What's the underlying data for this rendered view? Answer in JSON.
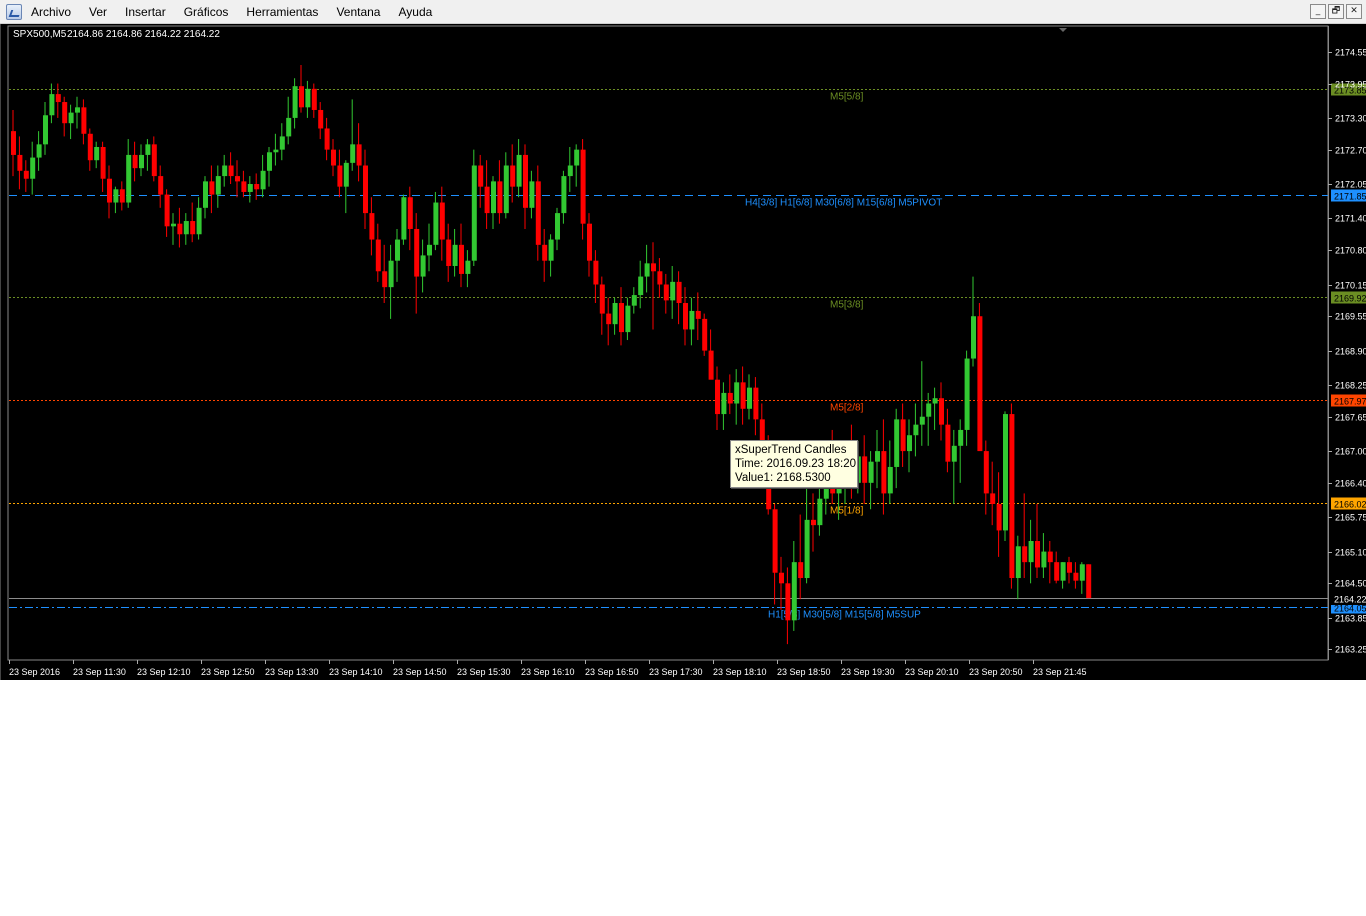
{
  "menubar": {
    "items": [
      "Archivo",
      "Ver",
      "Insertar",
      "Gráficos",
      "Herramientas",
      "Ventana",
      "Ayuda"
    ],
    "window_buttons": [
      "_",
      "🗗",
      "✕"
    ]
  },
  "chart_header": {
    "symbol": "SPX500,M5",
    "ohlc": "2164.86 2164.86 2164.22 2164.22"
  },
  "tooltip": {
    "title": "xSuperTrend Candles",
    "time": "Time: 2016.09.23 18:20",
    "value": "Value1: 2168.5300"
  },
  "colors": {
    "background": "#000000",
    "bull": "#32c832",
    "bear": "#ff0000",
    "axis_text": "#ffffff",
    "m5_58": "#6b8e23",
    "pivot": "#1e90ff",
    "m5_38": "#6b8e23",
    "m5_28": "#ff4500",
    "m5_18": "#ffa500",
    "sup": "#1e90ff"
  },
  "chart_data": {
    "type": "candlestick",
    "timeframe": "M5",
    "y_ticks": [
      "2174.55",
      "2173.95",
      "2173.30",
      "2172.70",
      "2172.05",
      "2171.40",
      "2170.80",
      "2170.15",
      "2169.55",
      "2168.90",
      "2168.25",
      "2167.65",
      "2167.00",
      "2166.40",
      "2165.75",
      "2165.10",
      "2164.50",
      "2163.85",
      "2163.25"
    ],
    "ylim": [
      2163.05,
      2175.0
    ],
    "x_tick_labels": [
      "23 Sep 2016",
      "23 Sep 11:30",
      "23 Sep 12:10",
      "23 Sep 12:50",
      "23 Sep 13:30",
      "23 Sep 14:10",
      "23 Sep 14:50",
      "23 Sep 15:30",
      "23 Sep 16:10",
      "23 Sep 16:50",
      "23 Sep 17:30",
      "23 Sep 18:10",
      "23 Sep 18:50",
      "23 Sep 19:30",
      "23 Sep 20:10",
      "23 Sep 20:50",
      "23 Sep 21:45"
    ],
    "levels": [
      {
        "label": "M5[5/8]",
        "price": 2173.85,
        "tag": "2173.85",
        "color": "#6b8e23",
        "style": "dot",
        "tag_bg": "#6b8e23",
        "label_color": "#6b8e23"
      },
      {
        "label": "H4[3/8] H1[6/8] M30[6/8] M15[6/8] M5PIVOT",
        "price": 2171.85,
        "tag": "2171.85",
        "color": "#1e90ff",
        "style": "dash",
        "tag_bg": "#1e90ff",
        "label_color": "#1e90ff"
      },
      {
        "label": "M5[3/8]",
        "price": 2169.92,
        "tag": "2169.92",
        "color": "#6b8e23",
        "style": "dot",
        "tag_bg": "#6b8e23",
        "label_color": "#6b8e23"
      },
      {
        "label": "M5[2/8]",
        "price": 2167.97,
        "tag": "2167.97",
        "color": "#ff4500",
        "style": "dot",
        "tag_bg": "#ff4500",
        "label_color": "#ff4500"
      },
      {
        "label": "M5[1/8]",
        "price": 2166.02,
        "tag": "2166.02",
        "color": "#ffa500",
        "style": "dot",
        "tag_bg": "#ffa500",
        "label_color": "#ffa500"
      },
      {
        "label": "H1[5/8] M30[5/8] M15[5/8] M5SUP",
        "price": 2164.05,
        "tag": "2164.05",
        "color": "#1e90ff",
        "style": "dashdot",
        "tag_bg": "#1e90ff",
        "label_color": "#1e90ff"
      }
    ],
    "current_price": {
      "price": 2164.22,
      "tag": "2164.22"
    },
    "candles": [
      [
        2173.05,
        2173.45,
        2172.2,
        2172.6
      ],
      [
        2172.6,
        2172.95,
        2171.95,
        2172.3
      ],
      [
        2172.3,
        2172.5,
        2171.9,
        2172.15
      ],
      [
        2172.15,
        2172.85,
        2171.85,
        2172.55
      ],
      [
        2172.55,
        2173.05,
        2172.3,
        2172.8
      ],
      [
        2172.8,
        2173.6,
        2172.6,
        2173.35
      ],
      [
        2173.35,
        2173.95,
        2173.2,
        2173.75
      ],
      [
        2173.75,
        2173.95,
        2173.3,
        2173.6
      ],
      [
        2173.6,
        2173.7,
        2172.95,
        2173.2
      ],
      [
        2173.2,
        2173.55,
        2172.9,
        2173.4
      ],
      [
        2173.4,
        2173.7,
        2173.1,
        2173.5
      ],
      [
        2173.5,
        2173.65,
        2172.8,
        2173.0
      ],
      [
        2173.0,
        2173.1,
        2172.3,
        2172.5
      ],
      [
        2172.5,
        2172.85,
        2172.35,
        2172.75
      ],
      [
        2172.75,
        2172.85,
        2171.9,
        2172.15
      ],
      [
        2172.15,
        2172.4,
        2171.4,
        2171.7
      ],
      [
        2171.7,
        2172.0,
        2171.5,
        2171.95
      ],
      [
        2171.95,
        2172.1,
        2171.55,
        2171.7
      ],
      [
        2171.7,
        2172.9,
        2171.6,
        2172.6
      ],
      [
        2172.6,
        2172.85,
        2172.1,
        2172.35
      ],
      [
        2172.35,
        2172.8,
        2172.2,
        2172.6
      ],
      [
        2172.6,
        2172.9,
        2172.3,
        2172.8
      ],
      [
        2172.8,
        2172.95,
        2172.1,
        2172.2
      ],
      [
        2172.2,
        2172.4,
        2171.6,
        2171.85
      ],
      [
        2171.85,
        2171.95,
        2171.05,
        2171.25
      ],
      [
        2171.25,
        2171.5,
        2170.9,
        2171.3
      ],
      [
        2171.3,
        2171.6,
        2170.85,
        2171.1
      ],
      [
        2171.1,
        2171.5,
        2170.9,
        2171.35
      ],
      [
        2171.35,
        2171.7,
        2170.95,
        2171.1
      ],
      [
        2171.1,
        2171.8,
        2171.0,
        2171.6
      ],
      [
        2171.6,
        2172.2,
        2171.4,
        2172.1
      ],
      [
        2172.1,
        2172.4,
        2171.5,
        2171.85
      ],
      [
        2171.85,
        2172.4,
        2171.6,
        2172.2
      ],
      [
        2172.2,
        2172.6,
        2172.0,
        2172.4
      ],
      [
        2172.4,
        2172.65,
        2172.05,
        2172.2
      ],
      [
        2172.2,
        2172.5,
        2171.8,
        2172.1
      ],
      [
        2172.1,
        2172.3,
        2171.8,
        2171.9
      ],
      [
        2171.9,
        2172.2,
        2171.7,
        2172.05
      ],
      [
        2172.05,
        2172.25,
        2171.75,
        2171.95
      ],
      [
        2171.95,
        2172.6,
        2171.8,
        2172.3
      ],
      [
        2172.3,
        2172.75,
        2172.0,
        2172.65
      ],
      [
        2172.65,
        2173.0,
        2172.4,
        2172.7
      ],
      [
        2172.7,
        2173.2,
        2172.5,
        2172.95
      ],
      [
        2172.95,
        2173.7,
        2172.8,
        2173.3
      ],
      [
        2173.3,
        2174.05,
        2173.1,
        2173.9
      ],
      [
        2173.9,
        2174.3,
        2173.4,
        2173.5
      ],
      [
        2173.5,
        2174.0,
        2173.3,
        2173.85
      ],
      [
        2173.85,
        2173.95,
        2173.3,
        2173.45
      ],
      [
        2173.45,
        2173.6,
        2172.9,
        2173.1
      ],
      [
        2173.1,
        2173.3,
        2172.5,
        2172.7
      ],
      [
        2172.7,
        2172.9,
        2172.2,
        2172.4
      ],
      [
        2172.4,
        2172.7,
        2171.8,
        2172.0
      ],
      [
        2172.0,
        2172.5,
        2171.5,
        2172.45
      ],
      [
        2172.45,
        2173.65,
        2172.3,
        2172.8
      ],
      [
        2172.8,
        2173.2,
        2172.1,
        2172.4
      ],
      [
        2172.4,
        2172.7,
        2171.2,
        2171.5
      ],
      [
        2171.5,
        2171.8,
        2170.7,
        2171.0
      ],
      [
        2171.0,
        2171.3,
        2170.2,
        2170.4
      ],
      [
        2170.4,
        2170.9,
        2169.8,
        2170.1
      ],
      [
        2170.1,
        2170.9,
        2169.5,
        2170.6
      ],
      [
        2170.6,
        2171.2,
        2170.2,
        2171.0
      ],
      [
        2171.0,
        2171.85,
        2170.9,
        2171.8
      ],
      [
        2171.8,
        2172.0,
        2170.8,
        2171.2
      ],
      [
        2171.2,
        2171.5,
        2169.6,
        2170.3
      ],
      [
        2170.3,
        2171.0,
        2170.0,
        2170.7
      ],
      [
        2170.7,
        2171.3,
        2170.4,
        2170.9
      ],
      [
        2170.9,
        2171.9,
        2170.8,
        2171.7
      ],
      [
        2171.7,
        2172.0,
        2170.6,
        2171.0
      ],
      [
        2171.0,
        2171.3,
        2170.2,
        2170.5
      ],
      [
        2170.5,
        2171.2,
        2170.3,
        2170.9
      ],
      [
        2170.9,
        2171.3,
        2170.1,
        2170.35
      ],
      [
        2170.35,
        2170.8,
        2170.1,
        2170.6
      ],
      [
        2170.6,
        2172.7,
        2170.5,
        2172.4
      ],
      [
        2172.4,
        2172.6,
        2171.6,
        2172.0
      ],
      [
        2172.0,
        2172.5,
        2171.2,
        2171.5
      ],
      [
        2171.5,
        2172.2,
        2171.2,
        2172.1
      ],
      [
        2172.1,
        2172.5,
        2171.3,
        2171.5
      ],
      [
        2171.5,
        2172.65,
        2171.4,
        2172.4
      ],
      [
        2172.4,
        2172.8,
        2171.7,
        2172.0
      ],
      [
        2172.0,
        2172.9,
        2171.8,
        2172.6
      ],
      [
        2172.6,
        2172.8,
        2171.2,
        2171.6
      ],
      [
        2171.6,
        2172.3,
        2171.4,
        2172.1
      ],
      [
        2172.1,
        2172.4,
        2170.6,
        2170.9
      ],
      [
        2170.9,
        2171.2,
        2170.2,
        2170.6
      ],
      [
        2170.6,
        2171.1,
        2170.3,
        2171.0
      ],
      [
        2171.0,
        2171.6,
        2170.8,
        2171.5
      ],
      [
        2171.5,
        2172.3,
        2171.3,
        2172.2
      ],
      [
        2172.2,
        2172.75,
        2171.9,
        2172.4
      ],
      [
        2172.4,
        2172.8,
        2172.0,
        2172.7
      ],
      [
        2172.7,
        2172.9,
        2171.0,
        2171.3
      ],
      [
        2171.3,
        2171.5,
        2170.3,
        2170.6
      ],
      [
        2170.6,
        2170.8,
        2169.8,
        2170.15
      ],
      [
        2170.15,
        2170.3,
        2169.2,
        2169.6
      ],
      [
        2169.6,
        2169.9,
        2169.0,
        2169.4
      ],
      [
        2169.4,
        2169.9,
        2169.2,
        2169.8
      ],
      [
        2169.8,
        2170.1,
        2169.0,
        2169.25
      ],
      [
        2169.25,
        2169.9,
        2169.1,
        2169.75
      ],
      [
        2169.75,
        2170.1,
        2169.6,
        2169.95
      ],
      [
        2169.95,
        2170.6,
        2169.7,
        2170.3
      ],
      [
        2170.3,
        2170.9,
        2170.0,
        2170.55
      ],
      [
        2170.55,
        2170.95,
        2169.3,
        2170.4
      ],
      [
        2170.4,
        2170.65,
        2169.9,
        2170.15
      ],
      [
        2170.15,
        2170.35,
        2169.6,
        2169.85
      ],
      [
        2169.85,
        2170.5,
        2169.5,
        2170.2
      ],
      [
        2170.2,
        2170.4,
        2169.4,
        2169.8
      ],
      [
        2169.8,
        2170.1,
        2169.0,
        2169.3
      ],
      [
        2169.3,
        2169.9,
        2169.0,
        2169.65
      ],
      [
        2169.65,
        2170.0,
        2169.1,
        2169.5
      ],
      [
        2169.5,
        2169.6,
        2168.8,
        2168.9
      ],
      [
        2168.9,
        2169.3,
        2168.6,
        2168.35
      ],
      [
        2168.35,
        2168.6,
        2167.4,
        2167.7
      ],
      [
        2167.7,
        2168.3,
        2167.4,
        2168.1
      ],
      [
        2168.1,
        2168.45,
        2167.7,
        2167.9
      ],
      [
        2167.9,
        2168.55,
        2167.5,
        2168.3
      ],
      [
        2168.3,
        2168.6,
        2167.5,
        2167.8
      ],
      [
        2167.8,
        2168.45,
        2167.6,
        2168.2
      ],
      [
        2168.2,
        2168.4,
        2167.3,
        2167.6
      ],
      [
        2167.6,
        2167.9,
        2166.8,
        2167.0
      ],
      [
        2167.0,
        2167.3,
        2165.8,
        2165.9
      ],
      [
        2165.9,
        2166.0,
        2164.1,
        2164.7
      ],
      [
        2164.7,
        2165.0,
        2164.0,
        2164.5
      ],
      [
        2164.5,
        2164.8,
        2163.35,
        2163.8
      ],
      [
        2163.8,
        2165.3,
        2163.6,
        2164.9
      ],
      [
        2164.9,
        2165.8,
        2164.2,
        2164.6
      ],
      [
        2164.6,
        2166.3,
        2164.5,
        2165.7
      ],
      [
        2165.7,
        2166.2,
        2165.1,
        2165.6
      ],
      [
        2165.6,
        2166.4,
        2165.4,
        2166.1
      ],
      [
        2166.1,
        2166.9,
        2165.8,
        2166.8
      ],
      [
        2166.8,
        2167.4,
        2166.0,
        2166.2
      ],
      [
        2166.2,
        2166.8,
        2165.7,
        2166.6
      ],
      [
        2166.6,
        2167.2,
        2166.0,
        2167.1
      ],
      [
        2167.1,
        2167.5,
        2166.1,
        2166.4
      ],
      [
        2166.4,
        2167.2,
        2166.2,
        2166.9
      ],
      [
        2166.9,
        2167.3,
        2166.0,
        2166.4
      ],
      [
        2166.4,
        2167.0,
        2165.9,
        2166.8
      ],
      [
        2166.8,
        2167.4,
        2166.3,
        2167.0
      ],
      [
        2167.0,
        2167.6,
        2165.8,
        2166.2
      ],
      [
        2166.2,
        2167.2,
        2166.0,
        2166.7
      ],
      [
        2166.7,
        2167.8,
        2166.3,
        2167.6
      ],
      [
        2167.6,
        2167.9,
        2166.7,
        2167.0
      ],
      [
        2167.0,
        2167.6,
        2166.6,
        2167.3
      ],
      [
        2167.3,
        2167.9,
        2166.9,
        2167.5
      ],
      [
        2167.5,
        2168.7,
        2167.1,
        2167.65
      ],
      [
        2167.65,
        2168.1,
        2167.1,
        2167.9
      ],
      [
        2167.9,
        2168.2,
        2167.4,
        2168.0
      ],
      [
        2168.0,
        2168.3,
        2167.2,
        2167.5
      ],
      [
        2167.5,
        2167.8,
        2166.6,
        2166.8
      ],
      [
        2166.8,
        2167.4,
        2166.0,
        2167.1
      ],
      [
        2167.1,
        2167.6,
        2166.4,
        2167.4
      ],
      [
        2167.4,
        2168.9,
        2167.1,
        2168.75
      ],
      [
        2168.75,
        2170.3,
        2168.6,
        2169.55
      ],
      [
        2169.55,
        2169.8,
        2167.4,
        2167.0
      ],
      [
        2167.0,
        2167.2,
        2165.8,
        2166.2
      ],
      [
        2166.2,
        2166.8,
        2165.6,
        2166.0
      ],
      [
        2166.0,
        2166.6,
        2165.0,
        2165.5
      ],
      [
        2165.5,
        2167.75,
        2165.3,
        2167.7
      ],
      [
        2167.7,
        2167.9,
        2164.4,
        2164.6
      ],
      [
        2164.6,
        2165.4,
        2164.2,
        2165.2
      ],
      [
        2165.2,
        2166.2,
        2164.6,
        2164.9
      ],
      [
        2164.9,
        2165.7,
        2164.5,
        2165.3
      ],
      [
        2165.3,
        2166.0,
        2164.6,
        2164.8
      ],
      [
        2164.8,
        2165.45,
        2164.6,
        2165.1
      ],
      [
        2165.1,
        2165.3,
        2164.5,
        2164.9
      ],
      [
        2164.9,
        2165.1,
        2164.5,
        2164.55
      ],
      [
        2164.55,
        2164.9,
        2164.4,
        2164.9
      ],
      [
        2164.9,
        2165.0,
        2164.5,
        2164.7
      ],
      [
        2164.7,
        2164.9,
        2164.4,
        2164.55
      ],
      [
        2164.55,
        2164.9,
        2164.3,
        2164.86
      ],
      [
        2164.86,
        2164.86,
        2164.22,
        2164.22
      ]
    ]
  }
}
